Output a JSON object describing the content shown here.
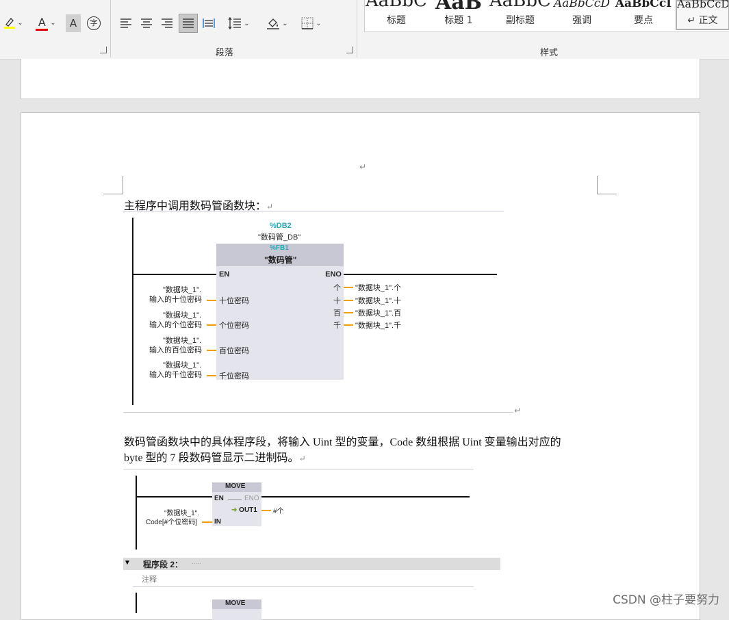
{
  "ribbon": {
    "font_group": {
      "highlight_icon": "highlighter-icon",
      "font_color_icon": "font-color-A-icon",
      "shading_label": "A",
      "char_border_label": "字"
    },
    "paragraph_group": {
      "label": "段落",
      "icons": [
        "align-left-icon",
        "align-center-icon",
        "align-right-icon",
        "justify-icon",
        "distributed-icon",
        "line-spacing-icon",
        "shading-icon",
        "borders-icon"
      ]
    },
    "styles_group": {
      "label": "样式",
      "items": [
        {
          "sample": "AaBbC",
          "name": "标题"
        },
        {
          "sample": "AaB",
          "name": "标题 1"
        },
        {
          "sample": "AaBbC",
          "name": "副标题"
        },
        {
          "sample": "AaBbCcD",
          "name": "强调"
        },
        {
          "sample": "AaBbCcI",
          "name": "要点"
        },
        {
          "sample": "AaBbCcD",
          "name": "↵ 正文"
        }
      ]
    }
  },
  "document": {
    "para1": "主程序中调用数码管函数块：",
    "para2_line1": "数码管函数块中的具体程序段，将输入 Uint 型的变量，Code 数组根据 Uint 变量输出对应的",
    "para2_line2": "byte 型的 7 段数码管显示二进制码。",
    "return_mark": "↵"
  },
  "figure1": {
    "db_id": "%DB2",
    "db_name": "\"数码管_DB\"",
    "fb_id": "%FB1",
    "fb_name": "\"数码管\"",
    "en": "EN",
    "eno": "ENO",
    "inputs": [
      {
        "pin": "十位密码",
        "var_line1": "\"数据块_1\".",
        "var_line2": "输入的十位密码"
      },
      {
        "pin": "个位密码",
        "var_line1": "\"数据块_1\".",
        "var_line2": "输入的个位密码"
      },
      {
        "pin": "百位密码",
        "var_line1": "\"数据块_1\".",
        "var_line2": "输入的百位密码"
      },
      {
        "pin": "千位密码",
        "var_line1": "\"数据块_1\".",
        "var_line2": "输入的千位密码"
      }
    ],
    "outputs": [
      {
        "pin": "个",
        "var": "\"数据块_1\".个"
      },
      {
        "pin": "十",
        "var": "\"数据块_1\".十"
      },
      {
        "pin": "百",
        "var": "\"数据块_1\".百"
      },
      {
        "pin": "千",
        "var": "\"数据块_1\".千"
      }
    ]
  },
  "figure2": {
    "block": "MOVE",
    "en": "EN",
    "eno": "ENO",
    "in_pin": "IN",
    "out_pin": "OUT1",
    "in_var_line1": "\"数据块_1\".",
    "in_var_line2": "Code[#个位密码]",
    "out_var": "#个",
    "segment_title": "程序段 2：",
    "segment_dots": ".....",
    "comment": "注释",
    "next_block": "MOVE"
  },
  "watermark": "CSDN @柱子要努力"
}
